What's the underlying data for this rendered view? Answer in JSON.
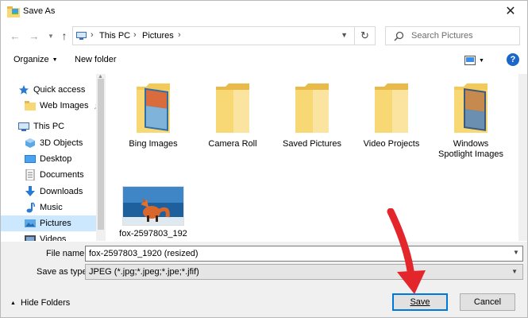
{
  "window": {
    "title": "Save As"
  },
  "nav": {
    "address": [
      "This PC",
      "Pictures"
    ],
    "search_placeholder": "Search Pictures"
  },
  "toolbar": {
    "organize_label": "Organize",
    "new_folder_label": "New folder",
    "help_label": "?"
  },
  "sidebar": {
    "items": [
      {
        "label": "Quick access",
        "icon": "star-icon",
        "pinned": false,
        "selected": false
      },
      {
        "label": "Web Images",
        "icon": "folder-icon",
        "pinned": true,
        "selected": false
      },
      {
        "label": "This PC",
        "icon": "computer-icon",
        "pinned": false,
        "selected": false
      },
      {
        "label": "3D Objects",
        "icon": "cube-icon",
        "pinned": false,
        "selected": false
      },
      {
        "label": "Desktop",
        "icon": "desktop-icon",
        "pinned": false,
        "selected": false
      },
      {
        "label": "Documents",
        "icon": "documents-icon",
        "pinned": false,
        "selected": false
      },
      {
        "label": "Downloads",
        "icon": "download-icon",
        "pinned": false,
        "selected": false
      },
      {
        "label": "Music",
        "icon": "music-icon",
        "pinned": false,
        "selected": false
      },
      {
        "label": "Pictures",
        "icon": "pictures-icon",
        "pinned": false,
        "selected": true
      },
      {
        "label": "Videos",
        "icon": "videos-icon",
        "pinned": false,
        "selected": false
      }
    ]
  },
  "files": [
    {
      "label": "Bing Images",
      "type": "folder-with-image"
    },
    {
      "label": "Camera Roll",
      "type": "folder"
    },
    {
      "label": "Saved Pictures",
      "type": "folder"
    },
    {
      "label": "Video Projects",
      "type": "folder"
    },
    {
      "label": "Windows Spotlight Images",
      "type": "folder-with-image"
    },
    {
      "label": "fox-2597803_192",
      "type": "image"
    }
  ],
  "form": {
    "filename_label": "File name:",
    "filename_value": "fox-2597803_1920 (resized)",
    "savetype_label": "Save as type:",
    "savetype_value": "JPEG (*.jpg;*.jpeg;*.jpe;*.jfif)"
  },
  "footer": {
    "hide_folders_label": "Hide Folders",
    "save_label": "Save",
    "cancel_label": "Cancel"
  },
  "colors": {
    "accent": "#0078d7",
    "selection": "#cce8ff",
    "folder": "#f8d775",
    "arrow": "#e3262b"
  }
}
